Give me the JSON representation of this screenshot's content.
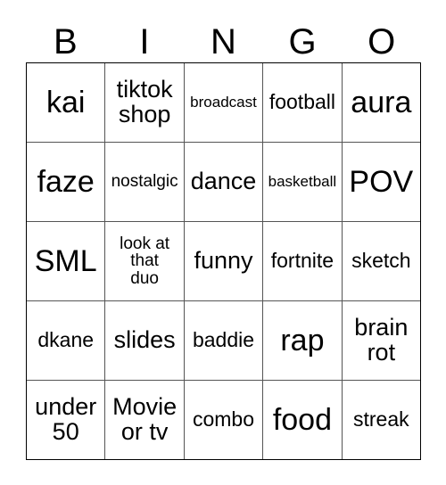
{
  "card": {
    "title_letters": [
      "B",
      "I",
      "N",
      "G",
      "O"
    ],
    "colors": {
      "background": "#ffffff",
      "text": "#000000",
      "outer_border": "#000000",
      "inner_border": "#555555"
    },
    "grid": {
      "columns": 5,
      "rows": 5,
      "cells": [
        [
          {
            "text": "kai",
            "size": "fs-xl"
          },
          {
            "text": "tiktok\nshop",
            "size": "fs-md"
          },
          {
            "text": "broadcast",
            "size": "fs-xxs"
          },
          {
            "text": "football",
            "size": "fs-sm"
          },
          {
            "text": "aura",
            "size": "fs-xl"
          }
        ],
        [
          {
            "text": "faze",
            "size": "fs-xl"
          },
          {
            "text": "nostalgic",
            "size": "fs-xs"
          },
          {
            "text": "dance",
            "size": "fs-md"
          },
          {
            "text": "basketball",
            "size": "fs-xxs"
          },
          {
            "text": "POV",
            "size": "fs-xl"
          }
        ],
        [
          {
            "text": "SML",
            "size": "fs-xl"
          },
          {
            "text": "look at\nthat\nduo",
            "size": "fs-xs"
          },
          {
            "text": "funny",
            "size": "fs-md"
          },
          {
            "text": "fortnite",
            "size": "fs-sm"
          },
          {
            "text": "sketch",
            "size": "fs-sm"
          }
        ],
        [
          {
            "text": "dkane",
            "size": "fs-sm"
          },
          {
            "text": "slides",
            "size": "fs-md"
          },
          {
            "text": "baddie",
            "size": "fs-sm"
          },
          {
            "text": "rap",
            "size": "fs-xl"
          },
          {
            "text": "brain\nrot",
            "size": "fs-md"
          }
        ],
        [
          {
            "text": "under\n50",
            "size": "fs-md"
          },
          {
            "text": "Movie\nor tv",
            "size": "fs-md"
          },
          {
            "text": "combo",
            "size": "fs-sm"
          },
          {
            "text": "food",
            "size": "fs-xl"
          },
          {
            "text": "streak",
            "size": "fs-sm"
          }
        ]
      ]
    }
  }
}
